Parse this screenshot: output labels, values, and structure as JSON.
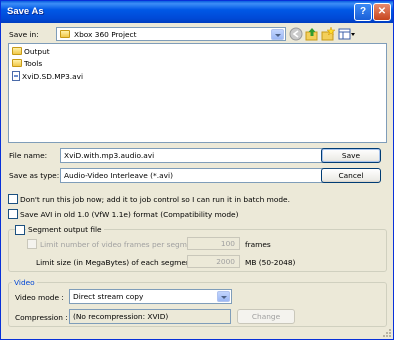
{
  "window": {
    "title": "Save As"
  },
  "titlebar": {
    "help_glyph": "?",
    "close_glyph": "✕"
  },
  "toolbar": {
    "save_in_label": "Save in:",
    "save_in_value": "Xbox 360 Project",
    "icons": [
      "back-icon",
      "up-folder-icon",
      "new-folder-icon",
      "view-menu-icon"
    ]
  },
  "file_list": {
    "items": [
      {
        "name": "Output",
        "icon": "folder-icon"
      },
      {
        "name": "Tools",
        "icon": "folder-icon"
      },
      {
        "name": "XviD.SD.MP3.avi",
        "icon": "avi-file-icon"
      }
    ]
  },
  "file_name": {
    "label": "File name:",
    "value": "XviD.with.mp3.audio.avi"
  },
  "save_as_type": {
    "label": "Save as type:",
    "value": "Audio-Video Interleave (*.avi)"
  },
  "buttons": {
    "save": "Save",
    "cancel": "Cancel",
    "change": "Change"
  },
  "options": {
    "batch": "Don't run this job now; add it to job control so I can run it in batch mode.",
    "old_avi": "Save AVI in old 1.0 (VfW 1.1e) format (Compatibility mode)"
  },
  "segment": {
    "title": "Segment output file",
    "limit_frames_label": "Limit number of video frames per segment to",
    "limit_frames_value": "100",
    "frames_unit": "frames",
    "limit_size_label": "Limit size (in MegaBytes) of each segment to :",
    "limit_size_value": "2000",
    "size_unit": "MB (50-2048)"
  },
  "video": {
    "title": "Video",
    "mode_label": "Video mode :",
    "mode_value": "Direct stream copy",
    "compression_label": "Compression :",
    "compression_value": "(No recompression: XVID)"
  },
  "colors": {
    "titlebar": "#0058e6",
    "dialog_bg": "#ece9d8",
    "field_border": "#7f9db9",
    "group_title": "#0046d5"
  }
}
